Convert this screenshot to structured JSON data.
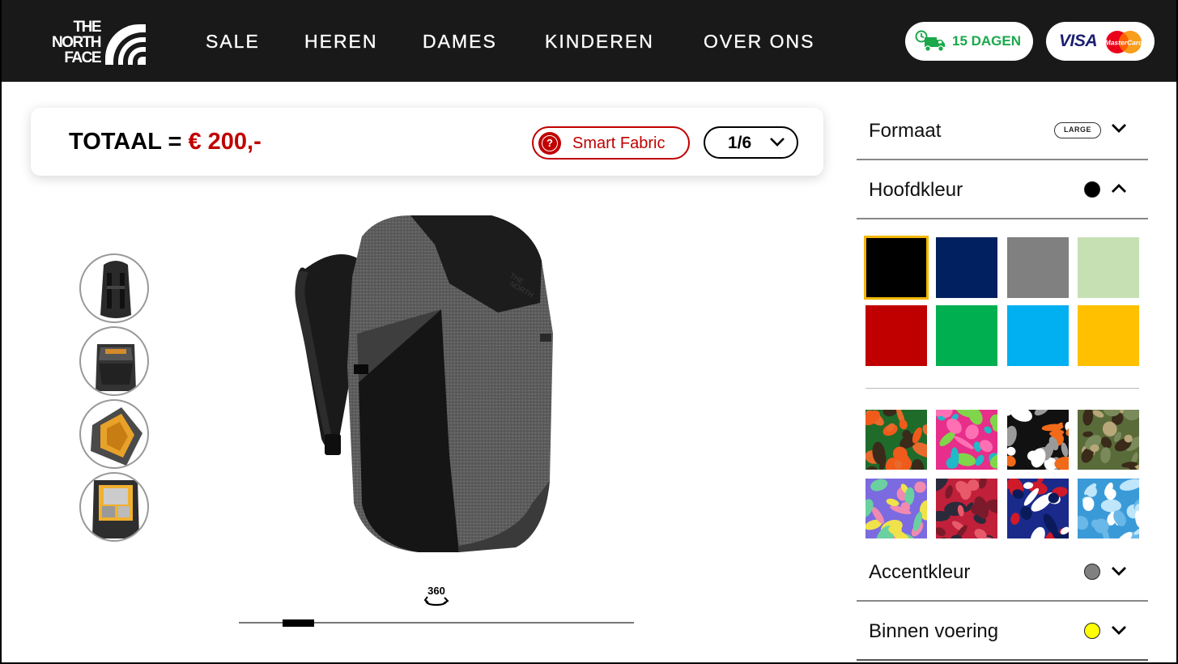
{
  "brand": {
    "logo_lines": [
      "THE",
      "NORTH",
      "FACE"
    ]
  },
  "nav": {
    "items": [
      "SALE",
      "HEREN",
      "DAMES",
      "KINDEREN",
      "OVER ONS"
    ]
  },
  "badges": {
    "delivery": "15 DAGEN",
    "visa": "VISA",
    "mastercard": "MasterCard"
  },
  "total": {
    "label": "TOTAAL = ",
    "price": "€ 200,-"
  },
  "smart_fabric": {
    "label": "Smart Fabric",
    "icon_glyph": "?"
  },
  "pager": {
    "value": "1/6"
  },
  "viewer": {
    "rotate_label": "360"
  },
  "options": {
    "formaat": {
      "label": "Formaat",
      "badge": "LARGE"
    },
    "hoofdkleur": {
      "label": "Hoofdkleur",
      "dot_color": "#000000"
    },
    "accentkleur": {
      "label": "Accentkleur",
      "dot_color": "#808080"
    },
    "binnen_voering": {
      "label": "Binnen voering",
      "dot_color": "#ffff00"
    }
  },
  "colors": {
    "solid": [
      "#000000",
      "#002060",
      "#808080",
      "#c6e0b4",
      "#c00000",
      "#00b050",
      "#00b0f0",
      "#ffc000"
    ],
    "selected_index": 0,
    "patterns": [
      {
        "name": "orange-camo",
        "colors": [
          "#1f6b2a",
          "#f05a1a",
          "#3a2a1a",
          "#e86a2c"
        ]
      },
      {
        "name": "pink-camo",
        "colors": [
          "#e62e8a",
          "#21b8c8",
          "#7fd64a",
          "#ff6fb4"
        ]
      },
      {
        "name": "urban-camo",
        "colors": [
          "#111111",
          "#f06a1a",
          "#9a9a9a",
          "#ffffff"
        ]
      },
      {
        "name": "woodland-camo",
        "colors": [
          "#5a6b3a",
          "#3a2a1a",
          "#b8a77a",
          "#7a8a5a"
        ]
      },
      {
        "name": "pastel-camo",
        "colors": [
          "#7b6ae0",
          "#f0e24a",
          "#6ad0a0",
          "#f08ab0"
        ]
      },
      {
        "name": "red-camo",
        "colors": [
          "#c0203a",
          "#2a2a3a",
          "#e85a6a",
          "#7a1a2a"
        ]
      },
      {
        "name": "flag-camo",
        "colors": [
          "#1a2a8a",
          "#d01a2a",
          "#ffffff",
          "#0a1a5a"
        ]
      },
      {
        "name": "blue-camo",
        "colors": [
          "#3a9ad8",
          "#bfe6fa",
          "#6ab8e8",
          "#ffffff"
        ]
      }
    ]
  },
  "slider": {
    "position": 0.12
  }
}
